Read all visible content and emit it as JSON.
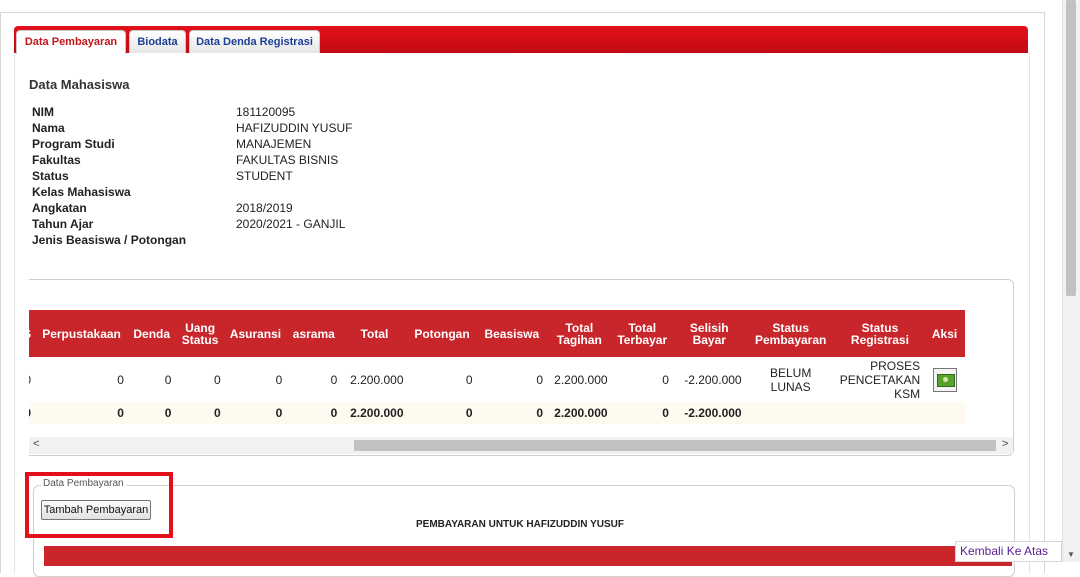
{
  "tabs": [
    "Data Pembayaran",
    "Biodata",
    "Data Denda Registrasi"
  ],
  "section_title": "Data Mahasiswa",
  "student_info": [
    {
      "label": "NIM",
      "value": "181120095"
    },
    {
      "label": "Nama",
      "value": "HAFIZUDDIN YUSUF"
    },
    {
      "label": "Program Studi",
      "value": "MANAJEMEN"
    },
    {
      "label": "Fakultas",
      "value": "FAKULTAS BISNIS"
    },
    {
      "label": "Status",
      "value": "STUDENT"
    },
    {
      "label": "Kelas Mahasiswa",
      "value": ""
    },
    {
      "label": "Angkatan",
      "value": "2018/2019"
    },
    {
      "label": "Tahun Ajar",
      "value": "2020/2021 - GANJIL"
    },
    {
      "label": "Jenis Beasiswa / Potongan",
      "value": ""
    }
  ],
  "payment_table": {
    "headers": [
      "S",
      "Perpustakaan",
      "Denda",
      "Uang Status",
      "Asuransi",
      "asrama",
      "Total",
      "Potongan",
      "Beasiswa",
      "Total Tagihan",
      "Total Terbayar",
      "Selisih Bayar",
      "Status Pembayaran",
      "Status Registrasi",
      "Aksi"
    ],
    "row": {
      "cells": [
        "0",
        "0",
        "0",
        "0",
        "0",
        "0",
        "2.200.000",
        "0",
        "0",
        "2.200.000",
        "0",
        "-2.200.000"
      ],
      "status_pembayaran": "BELUM LUNAS",
      "status_registrasi": "PROSES PENCETAKAN KSM",
      "action_icon": "money-icon"
    },
    "total_row": [
      "0",
      "0",
      "0",
      "0",
      "0",
      "0",
      "2.200.000",
      "0",
      "0",
      "2.200.000",
      "0",
      "-2.200.000",
      "",
      "",
      ""
    ]
  },
  "payment_section": {
    "legend": "Data Pembayaran",
    "add_button": "Tambah Pembayaran",
    "heading": "PEMBAYARAN UNTUK HAFIZUDDIN YUSUF"
  },
  "back_to_top": "Kembali Ke Atas",
  "colors": {
    "accent": "#c9262c",
    "tab_active_text": "#c3161c",
    "link": "#1a2fbf",
    "highlight": "#e3101b"
  }
}
